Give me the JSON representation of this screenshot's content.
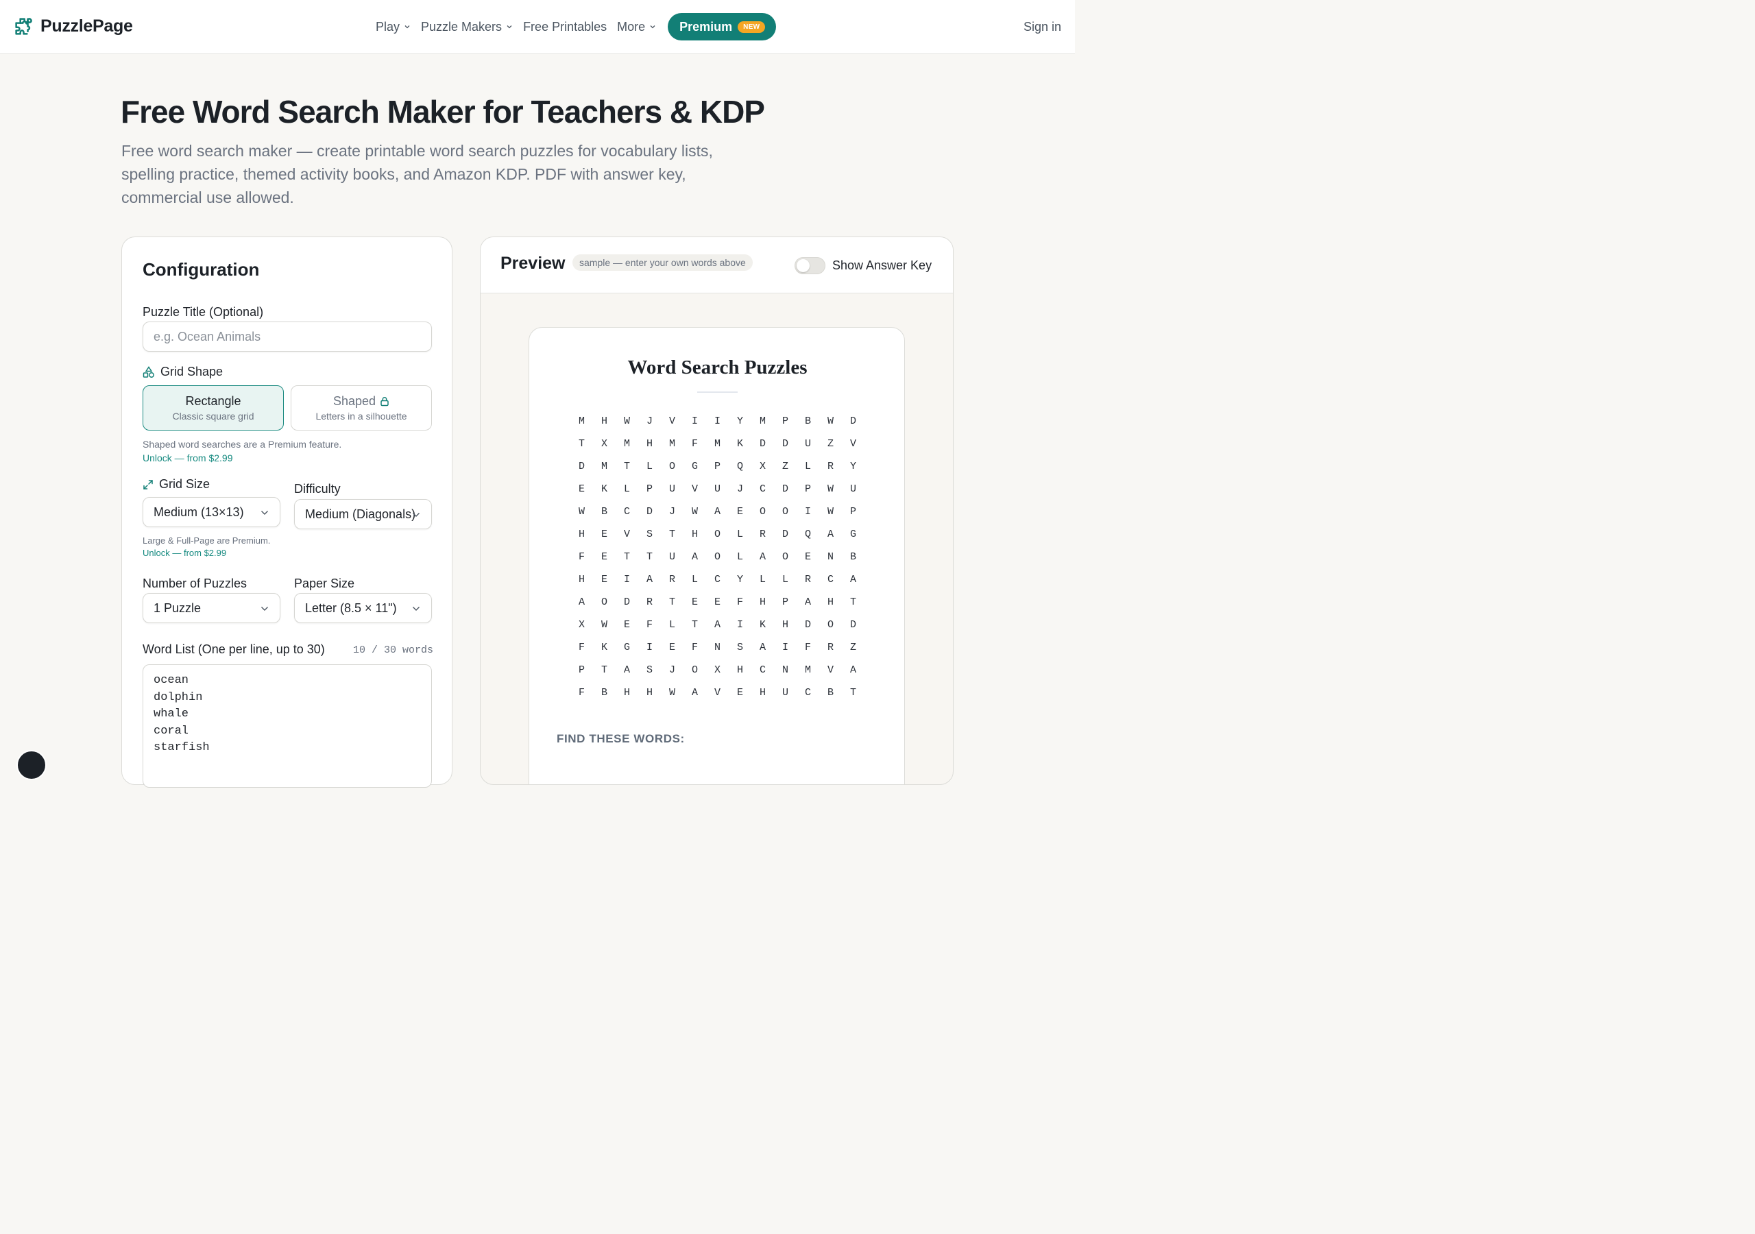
{
  "header": {
    "logo_text": "PuzzlePage",
    "nav": [
      {
        "label": "Play",
        "has_dropdown": true
      },
      {
        "label": "Puzzle Makers",
        "has_dropdown": true
      },
      {
        "label": "Free Printables",
        "has_dropdown": false
      },
      {
        "label": "More",
        "has_dropdown": true
      }
    ],
    "premium_label": "Premium",
    "premium_badge": "NEW",
    "signin_label": "Sign in"
  },
  "hero": {
    "title": "Free Word Search Maker for Teachers & KDP",
    "subtitle": "Free word search maker — create printable word search puzzles for vocabulary lists, spelling practice, themed activity books, and Amazon KDP. PDF with answer key, commercial use allowed."
  },
  "config": {
    "title": "Configuration",
    "puzzle_title_label": "Puzzle Title (Optional)",
    "puzzle_title_placeholder": "e.g. Ocean Animals",
    "grid_shape_label": "Grid Shape",
    "shape_options": [
      {
        "name": "Rectangle",
        "desc": "Classic square grid",
        "selected": true
      },
      {
        "name": "Shaped",
        "desc": "Letters in a silhouette",
        "selected": false,
        "locked": true
      }
    ],
    "shape_note": "Shaped word searches are a Premium feature.",
    "shape_unlock": "Unlock — from $2.99",
    "grid_size_label": "Grid Size",
    "grid_size_value": "Medium (13×13)",
    "difficulty_label": "Difficulty",
    "difficulty_value": "Medium (Diagonals)",
    "size_note": "Large & Full-Page are Premium.",
    "size_unlock": "Unlock — from $2.99",
    "num_puzzles_label": "Number of Puzzles",
    "num_puzzles_value": "1 Puzzle",
    "paper_size_label": "Paper Size",
    "paper_size_value": "Letter (8.5 × 11\")",
    "word_list_label": "Word List (One per line, up to 30)",
    "word_count": "10 / 30 words",
    "words": [
      "ocean",
      "dolphin",
      "whale",
      "coral",
      "starfish"
    ]
  },
  "preview": {
    "title": "Preview",
    "sample_note": "sample — enter your own words above",
    "answer_key_label": "Show Answer Key",
    "answer_key_on": false,
    "sheet_title": "Word Search Puzzles",
    "grid": [
      [
        "M",
        "H",
        "W",
        "J",
        "V",
        "I",
        "I",
        "Y",
        "M",
        "P",
        "B",
        "W",
        "D"
      ],
      [
        "T",
        "X",
        "M",
        "H",
        "M",
        "F",
        "M",
        "K",
        "D",
        "D",
        "U",
        "Z",
        "V"
      ],
      [
        "D",
        "M",
        "T",
        "L",
        "O",
        "G",
        "P",
        "Q",
        "X",
        "Z",
        "L",
        "R",
        "Y"
      ],
      [
        "E",
        "K",
        "L",
        "P",
        "U",
        "V",
        "U",
        "J",
        "C",
        "D",
        "P",
        "W",
        "U"
      ],
      [
        "W",
        "B",
        "C",
        "D",
        "J",
        "W",
        "A",
        "E",
        "O",
        "O",
        "I",
        "W",
        "P"
      ],
      [
        "H",
        "E",
        "V",
        "S",
        "T",
        "H",
        "O",
        "L",
        "R",
        "D",
        "Q",
        "A",
        "G"
      ],
      [
        "F",
        "E",
        "T",
        "T",
        "U",
        "A",
        "O",
        "L",
        "A",
        "O",
        "E",
        "N",
        "B"
      ],
      [
        "H",
        "E",
        "I",
        "A",
        "R",
        "L",
        "C",
        "Y",
        "L",
        "L",
        "R",
        "C",
        "A"
      ],
      [
        "A",
        "O",
        "D",
        "R",
        "T",
        "E",
        "E",
        "F",
        "H",
        "P",
        "A",
        "H",
        "T"
      ],
      [
        "X",
        "W",
        "E",
        "F",
        "L",
        "T",
        "A",
        "I",
        "K",
        "H",
        "D",
        "O",
        "D"
      ],
      [
        "F",
        "K",
        "G",
        "I",
        "E",
        "F",
        "N",
        "S",
        "A",
        "I",
        "F",
        "R",
        "Z"
      ],
      [
        "P",
        "T",
        "A",
        "S",
        "J",
        "O",
        "X",
        "H",
        "C",
        "N",
        "M",
        "V",
        "A"
      ],
      [
        "F",
        "B",
        "H",
        "H",
        "W",
        "A",
        "V",
        "E",
        "H",
        "U",
        "C",
        "B",
        "T"
      ]
    ],
    "find_title": "FIND THESE WORDS:"
  },
  "colors": {
    "accent": "#127f76",
    "badge": "#f5a623",
    "background": "#f8f7f4"
  }
}
